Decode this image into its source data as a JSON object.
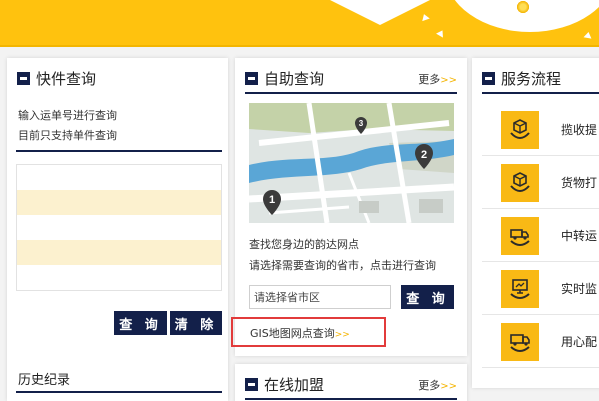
{
  "quick_query": {
    "title": "快件查询",
    "line1": "输入运单号进行查询",
    "line2": "目前只支持单件查询",
    "query_button": "查 询",
    "clear_button": "清 除",
    "history_title": "历史纪录"
  },
  "self_query": {
    "title": "自助查询",
    "more": "更多",
    "more_arrow": ">>",
    "line1": "查找您身边的韵达网点",
    "line2": "请选择需要查询的省市，点击进行查询",
    "region_placeholder": "请选择省市区",
    "query_button": "查 询",
    "gis_link": "GIS地图网点查询",
    "gis_arrow": ">>",
    "map_pins": [
      "1",
      "2",
      "3"
    ]
  },
  "online_join": {
    "title": "在线加盟",
    "more": "更多",
    "more_arrow": ">>"
  },
  "service_flow": {
    "title": "服务流程",
    "items": [
      {
        "label": "揽收提",
        "icon": "box-pickup-icon"
      },
      {
        "label": "货物打",
        "icon": "box-pack-icon"
      },
      {
        "label": "中转运",
        "icon": "truck-transfer-icon"
      },
      {
        "label": "实时监",
        "icon": "monitor-icon"
      },
      {
        "label": "用心配",
        "icon": "delivery-truck-icon"
      }
    ]
  },
  "colors": {
    "brand_yellow": "#ffc20e",
    "navy": "#13204a",
    "highlight_red": "#e23b3b"
  }
}
